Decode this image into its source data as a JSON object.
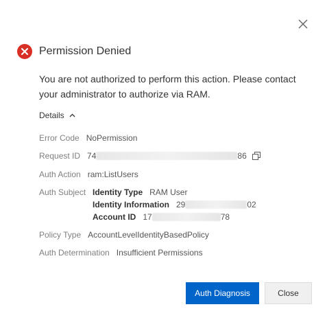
{
  "dialog": {
    "title": "Permission Denied",
    "message": "You are not authorized to perform this action. Please contact your administrator to authorize via RAM.",
    "details_label": "Details",
    "fields": {
      "error_code": {
        "label": "Error Code",
        "value": "NoPermission"
      },
      "request_id": {
        "label": "Request ID",
        "prefix": "74",
        "suffix": "86"
      },
      "auth_action": {
        "label": "Auth Action",
        "value": "ram:ListUsers"
      },
      "auth_subject": {
        "label": "Auth Subject",
        "identity_type": {
          "label": "Identity Type",
          "value": "RAM User"
        },
        "identity_information": {
          "label": "Identity Information",
          "prefix": "29",
          "suffix": "02"
        },
        "account_id": {
          "label": "Account ID",
          "prefix": "17",
          "suffix": "78"
        }
      },
      "policy_type": {
        "label": "Policy Type",
        "value": "AccountLevelIdentityBasedPolicy"
      },
      "auth_determination": {
        "label": "Auth Determination",
        "value": "Insufficient Permissions"
      }
    },
    "buttons": {
      "auth_diagnosis": "Auth Diagnosis",
      "close": "Close"
    }
  },
  "colors": {
    "error_red": "#d93026",
    "primary_blue": "#0064c8"
  },
  "icons": [
    "close-icon",
    "error-icon",
    "chevron-up-icon",
    "copy-icon"
  ]
}
